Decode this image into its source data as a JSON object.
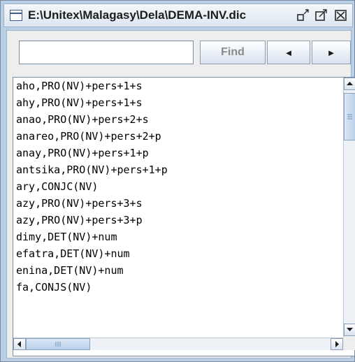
{
  "window": {
    "title": "E:\\Unitex\\Malagasy\\Dela\\DEMA-INV.dic",
    "icons": [
      "window-app-icon",
      "restore-icon",
      "maximize-icon",
      "close-icon"
    ]
  },
  "search": {
    "value": "",
    "placeholder": "",
    "find_label": "Find",
    "prev_label": "◄",
    "next_label": "►"
  },
  "entries": [
    "aho,PRO(NV)+pers+1+s",
    "ahy,PRO(NV)+pers+1+s",
    "anao,PRO(NV)+pers+2+s",
    "anareo,PRO(NV)+pers+2+p",
    "anay,PRO(NV)+pers+1+p",
    "antsika,PRO(NV)+pers+1+p",
    "ary,CONJC(NV)",
    "azy,PRO(NV)+pers+3+s",
    "azy,PRO(NV)+pers+3+p",
    "dimy,DET(NV)+num",
    "efatra,DET(NV)+num",
    "enina,DET(NV)+num",
    "fa,CONJS(NV)"
  ]
}
